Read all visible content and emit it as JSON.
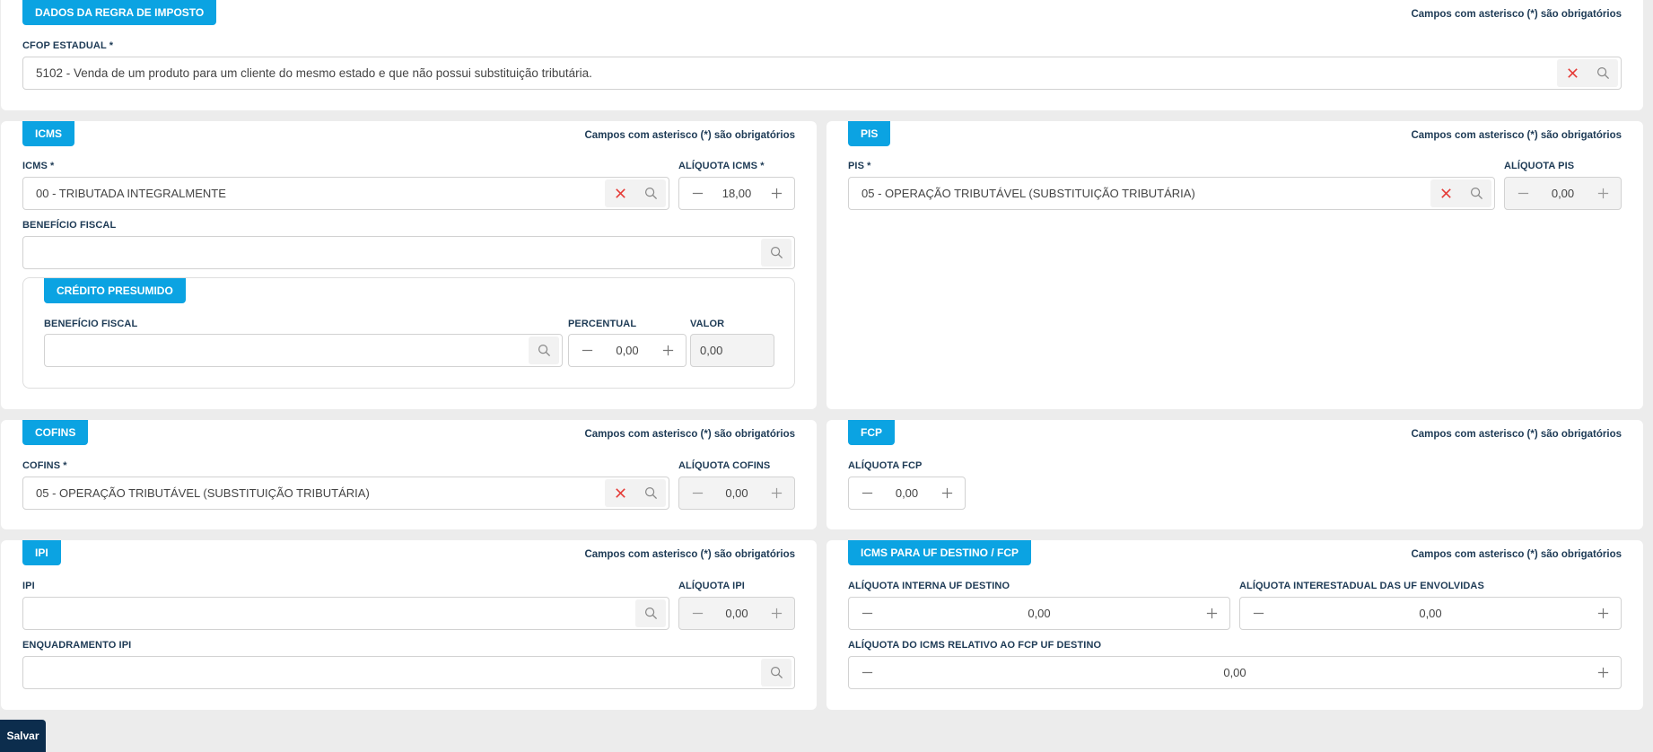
{
  "required_note": "Campos com asterisco (*) são obrigatórios",
  "dados": {
    "title": "DADOS DA REGRA DE IMPOSTO",
    "cfop_label": "CFOP ESTADUAL *",
    "cfop_value": "5102 - Venda de um produto para um cliente do mesmo estado e que não possui substituição tributária."
  },
  "icms": {
    "title": "ICMS",
    "icms_label": "ICMS *",
    "icms_value": "00 - TRIBUTADA INTEGRALMENTE",
    "aliquota_label": "ALÍQUOTA ICMS *",
    "aliquota_value": "18,00",
    "beneficio_label": "BENEFÍCIO FISCAL",
    "beneficio_value": "",
    "credito": {
      "title": "CRÉDITO PRESUMIDO",
      "beneficio_label": "BENEFÍCIO FISCAL",
      "beneficio_value": "",
      "percentual_label": "PERCENTUAL",
      "percentual_value": "0,00",
      "valor_label": "VALOR",
      "valor_value": "0,00"
    }
  },
  "pis": {
    "title": "PIS",
    "pis_label": "PIS *",
    "pis_value": "05 - OPERAÇÃO TRIBUTÁVEL (SUBSTITUIÇÃO TRIBUTÁRIA)",
    "aliquota_label": "ALÍQUOTA PIS",
    "aliquota_value": "0,00"
  },
  "cofins": {
    "title": "COFINS",
    "cofins_label": "COFINS *",
    "cofins_value": "05 - OPERAÇÃO TRIBUTÁVEL (SUBSTITUIÇÃO TRIBUTÁRIA)",
    "aliquota_label": "ALÍQUOTA COFINS",
    "aliquota_value": "0,00"
  },
  "fcp": {
    "title": "FCP",
    "aliquota_label": "ALÍQUOTA FCP",
    "aliquota_value": "0,00"
  },
  "ipi": {
    "title": "IPI",
    "ipi_label": "IPI",
    "ipi_value": "",
    "aliquota_label": "ALÍQUOTA IPI",
    "aliquota_value": "0,00",
    "enquadramento_label": "ENQUADRAMENTO IPI",
    "enquadramento_value": ""
  },
  "uf_destino": {
    "title": "ICMS PARA UF DESTINO / FCP",
    "interna_label": "ALÍQUOTA INTERNA UF DESTINO",
    "interna_value": "0,00",
    "interestadual_label": "ALÍQUOTA INTERESTADUAL DAS UF ENVOLVIDAS",
    "interestadual_value": "0,00",
    "fcp_label": "ALÍQUOTA DO ICMS RELATIVO AO FCP UF DESTINO",
    "fcp_value": "0,00"
  },
  "save_label": "Salvar",
  "colors": {
    "accent": "#0ba3e2",
    "label": "#1d3a55",
    "clear": "#e53935",
    "save": "#0c2d4d"
  }
}
